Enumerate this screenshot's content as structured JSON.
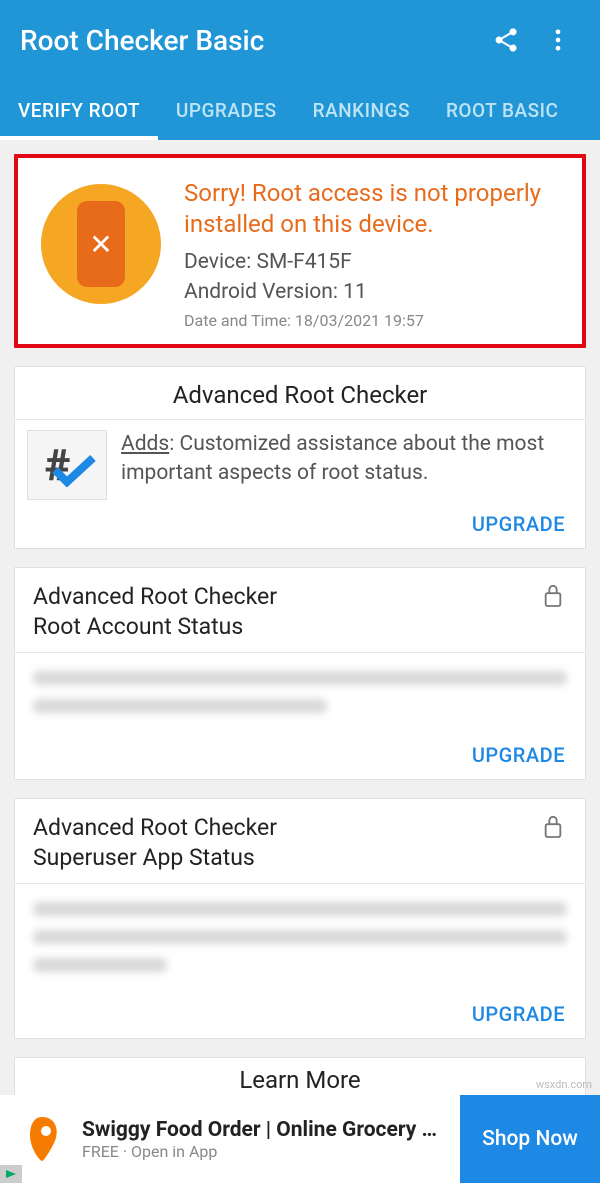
{
  "appbar": {
    "title": "Root Checker Basic"
  },
  "tabs": {
    "items": [
      "VERIFY ROOT",
      "UPGRADES",
      "RANKINGS",
      "ROOT BASIC"
    ],
    "active": 0
  },
  "status": {
    "message": "Sorry! Root access is not properly installed on this device.",
    "device_label": "Device: SM-F415F",
    "android_label": "Android Version: 11",
    "datetime_label": "Date and Time: 18/03/2021 19:57"
  },
  "adv_checker": {
    "title": "Advanced Root Checker",
    "adds_label": "Adds",
    "desc": ": Customized assistance about the most important aspects of root status.",
    "upgrade": "UPGRADE"
  },
  "root_account": {
    "title_line1": "Advanced Root Checker",
    "title_line2": "Root Account Status",
    "upgrade": "UPGRADE"
  },
  "superuser": {
    "title_line1": "Advanced Root Checker",
    "title_line2": "Superuser App Status",
    "upgrade": "UPGRADE"
  },
  "learn_more": "Learn More",
  "ad": {
    "title": "Swiggy Food Order | Online Grocery …",
    "sub": "FREE · Open in App",
    "button": "Shop Now"
  },
  "watermark": "wsxdn.com"
}
